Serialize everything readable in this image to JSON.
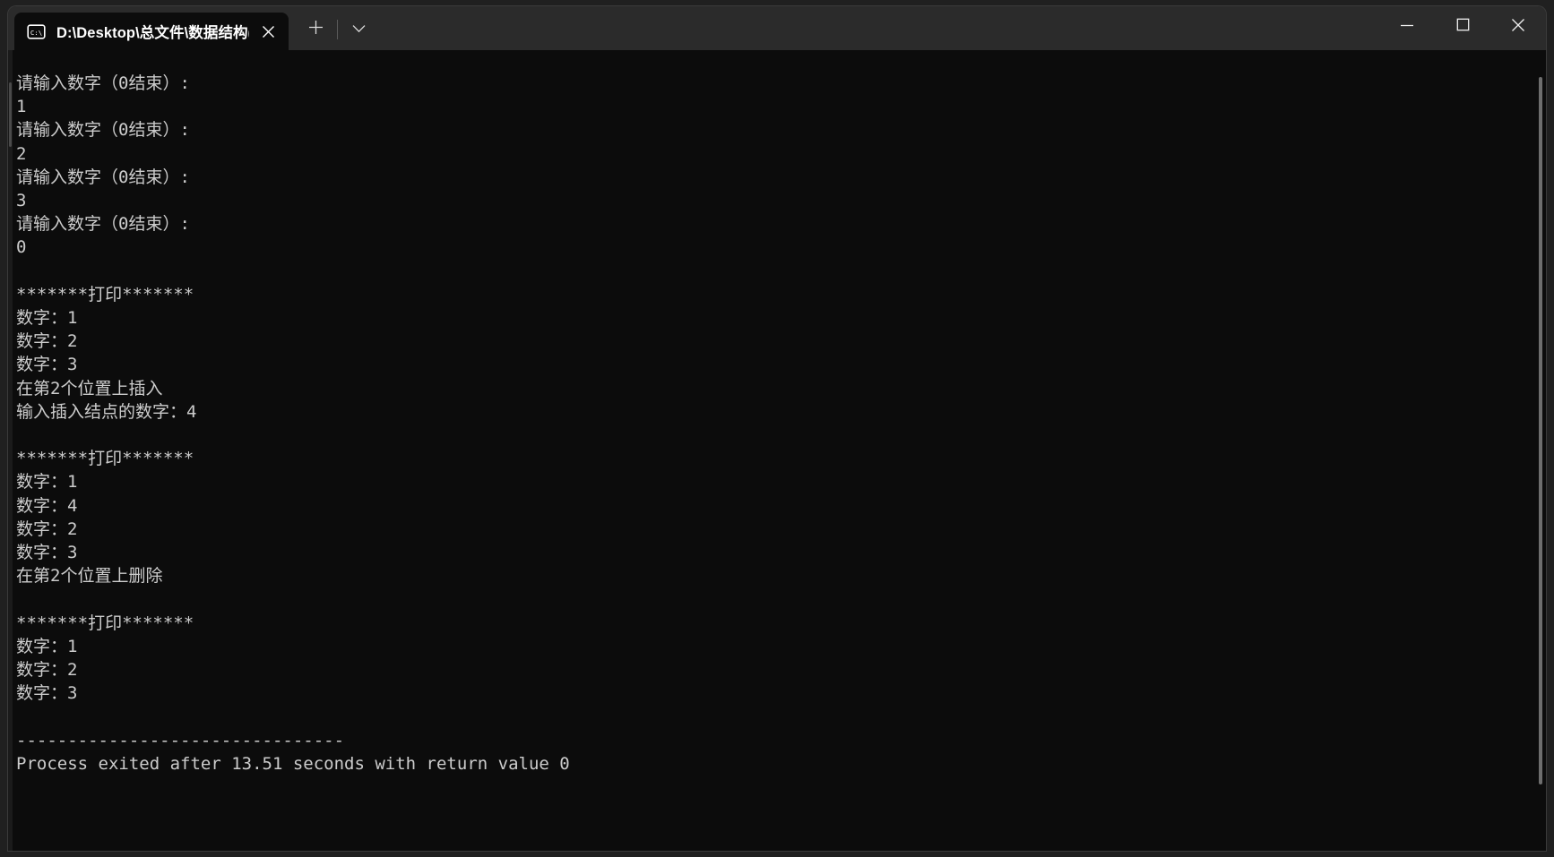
{
  "window": {
    "tab": {
      "icon": "console-cmd-icon",
      "title": "D:\\Desktop\\总文件\\数据结构(",
      "close_icon": "close-icon"
    },
    "new_tab_icon": "plus-icon",
    "tab_dropdown_icon": "chevron-down-icon",
    "controls": {
      "minimize_icon": "minimize-icon",
      "maximize_icon": "maximize-icon",
      "close_icon": "close-icon"
    }
  },
  "terminal": {
    "colors": {
      "background": "#0c0c0c",
      "foreground": "#cccccc",
      "titlebar": "#2b2b2b"
    },
    "output": "请输入数字（0结束）:\n1\n请输入数字（0结束）:\n2\n请输入数字（0结束）:\n3\n请输入数字（0结束）:\n0\n\n*******打印*******\n数字：1\n数字：2\n数字：3\n在第2个位置上插入\n输入插入结点的数字：4\n\n*******打印*******\n数字：1\n数字：4\n数字：2\n数字：3\n在第2个位置上删除\n\n*******打印*******\n数字：1\n数字：2\n数字：3\n\n--------------------------------\nProcess exited after 13.51 seconds with return value 0",
    "lines": [
      "请输入数字（0结束）:",
      "1",
      "请输入数字（0结束）:",
      "2",
      "请输入数字（0结束）:",
      "3",
      "请输入数字（0结束）:",
      "0",
      "",
      "*******打印*******",
      "数字：1",
      "数字：2",
      "数字：3",
      "在第2个位置上插入",
      "输入插入结点的数字：4",
      "",
      "*******打印*******",
      "数字：1",
      "数字：4",
      "数字：2",
      "数字：3",
      "在第2个位置上删除",
      "",
      "*******打印*******",
      "数字：1",
      "数字：2",
      "数字：3",
      "",
      "--------------------------------",
      "Process exited after 13.51 seconds with return value 0"
    ]
  }
}
